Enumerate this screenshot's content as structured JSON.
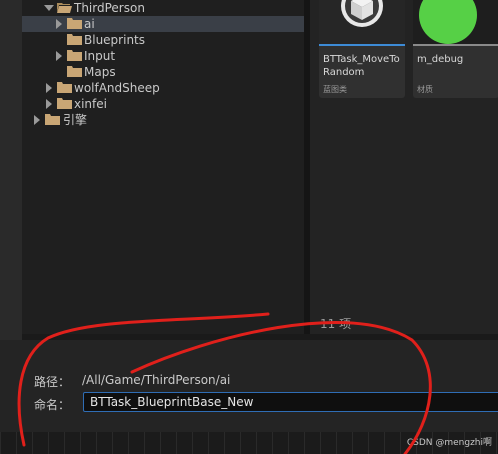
{
  "tree": {
    "items": [
      {
        "label": "ThirdPerson",
        "expanded": true
      },
      {
        "label": "ai",
        "selected": true
      },
      {
        "label": "Blueprints"
      },
      {
        "label": "Input"
      },
      {
        "label": "Maps"
      },
      {
        "label": "wolfAndSheep"
      },
      {
        "label": "xinfei"
      },
      {
        "label": "引擎"
      }
    ]
  },
  "assets": [
    {
      "name": "BTTask_MoveToRandom",
      "name_line3": "...",
      "type": "蓝图类",
      "icon": "cube-icon",
      "accent": "#3d8bd6"
    },
    {
      "name": "m_debug",
      "type": "材质",
      "icon": "green-sphere-icon",
      "accent": "#8a8a8a"
    }
  ],
  "asset_panel": {
    "item_count": "11 项"
  },
  "save_dialog": {
    "path_label": "路径：",
    "path_value": "/All/Game/ThirdPerson/ai",
    "name_label": "命名：",
    "name_value": "BTTask_BlueprintBase_New"
  },
  "watermark": "CSDN @mengzhi啊",
  "colors": {
    "selection": "#3a3f47",
    "input_border": "#2f6db5",
    "folder": "#c9a675",
    "annotation": "#e0201b",
    "material_sphere": "#56d046"
  }
}
